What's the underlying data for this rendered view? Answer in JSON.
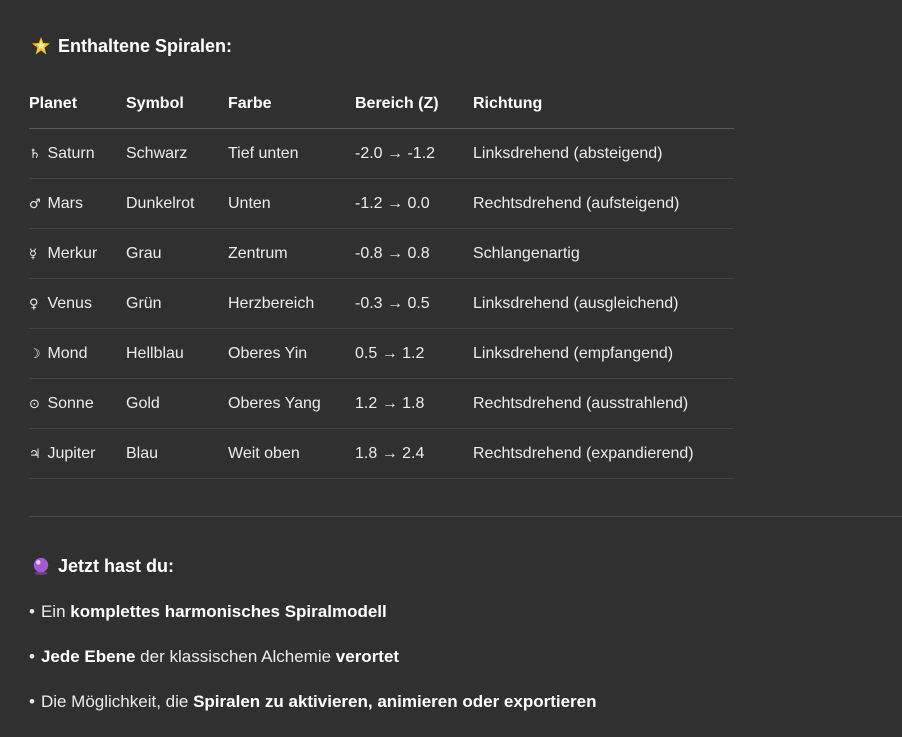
{
  "spirals_heading": {
    "icon": "glowing-star-icon",
    "text": "Enthaltene Spiralen:"
  },
  "table": {
    "headers": [
      "Planet",
      "Symbol",
      "Farbe",
      "Bereich (Z)",
      "Richtung"
    ],
    "rows": [
      {
        "glyph": "♄",
        "planet": "Saturn",
        "symbol": "Schwarz",
        "farbe": "Tief unten",
        "bereich": "-2.0 → -1.2",
        "richtung": "Linksdrehend (absteigend)"
      },
      {
        "glyph": "♂",
        "planet": "Mars",
        "symbol": "Dunkelrot",
        "farbe": "Unten",
        "bereich": "-1.2 → 0.0",
        "richtung": "Rechtsdrehend (aufsteigend)"
      },
      {
        "glyph": "☿",
        "planet": "Merkur",
        "symbol": "Grau",
        "farbe": "Zentrum",
        "bereich": "-0.8 → 0.8",
        "richtung": "Schlangenartig"
      },
      {
        "glyph": "♀",
        "planet": "Venus",
        "symbol": "Grün",
        "farbe": "Herzbereich",
        "bereich": "-0.3 → 0.5",
        "richtung": "Linksdrehend (ausgleichend)"
      },
      {
        "glyph": "☽",
        "planet": "Mond",
        "symbol": "Hellblau",
        "farbe": "Oberes Yin",
        "bereich": "0.5 → 1.2",
        "richtung": "Linksdrehend (empfangend)"
      },
      {
        "glyph": "⊙",
        "planet": "Sonne",
        "symbol": "Gold",
        "farbe": "Oberes Yang",
        "bereich": "1.2 → 1.8",
        "richtung": "Rechtsdrehend (ausstrahlend)"
      },
      {
        "glyph": "♃",
        "planet": "Jupiter",
        "symbol": "Blau",
        "farbe": "Weit oben",
        "bereich": "1.8 → 2.4",
        "richtung": "Rechtsdrehend (expandierend)"
      }
    ]
  },
  "now_heading": {
    "icon": "crystal-ball-icon",
    "text": "Jetzt hast du:"
  },
  "bullets": [
    {
      "parts": [
        {
          "t": "Ein ",
          "b": false
        },
        {
          "t": "komplettes harmonisches Spiralmodell",
          "b": true
        }
      ]
    },
    {
      "parts": [
        {
          "t": "Jede Ebene",
          "b": true
        },
        {
          "t": " der klassischen Alchemie ",
          "b": false
        },
        {
          "t": "verortet",
          "b": true
        }
      ]
    },
    {
      "parts": [
        {
          "t": "Die Möglichkeit, die ",
          "b": false
        },
        {
          "t": "Spiralen zu aktivieren, animieren oder exportieren",
          "b": true
        }
      ]
    }
  ],
  "colors": {
    "background": "#303030",
    "text": "#ececec",
    "star": "#f5c518",
    "crystal_ball": "#a35ccf"
  }
}
